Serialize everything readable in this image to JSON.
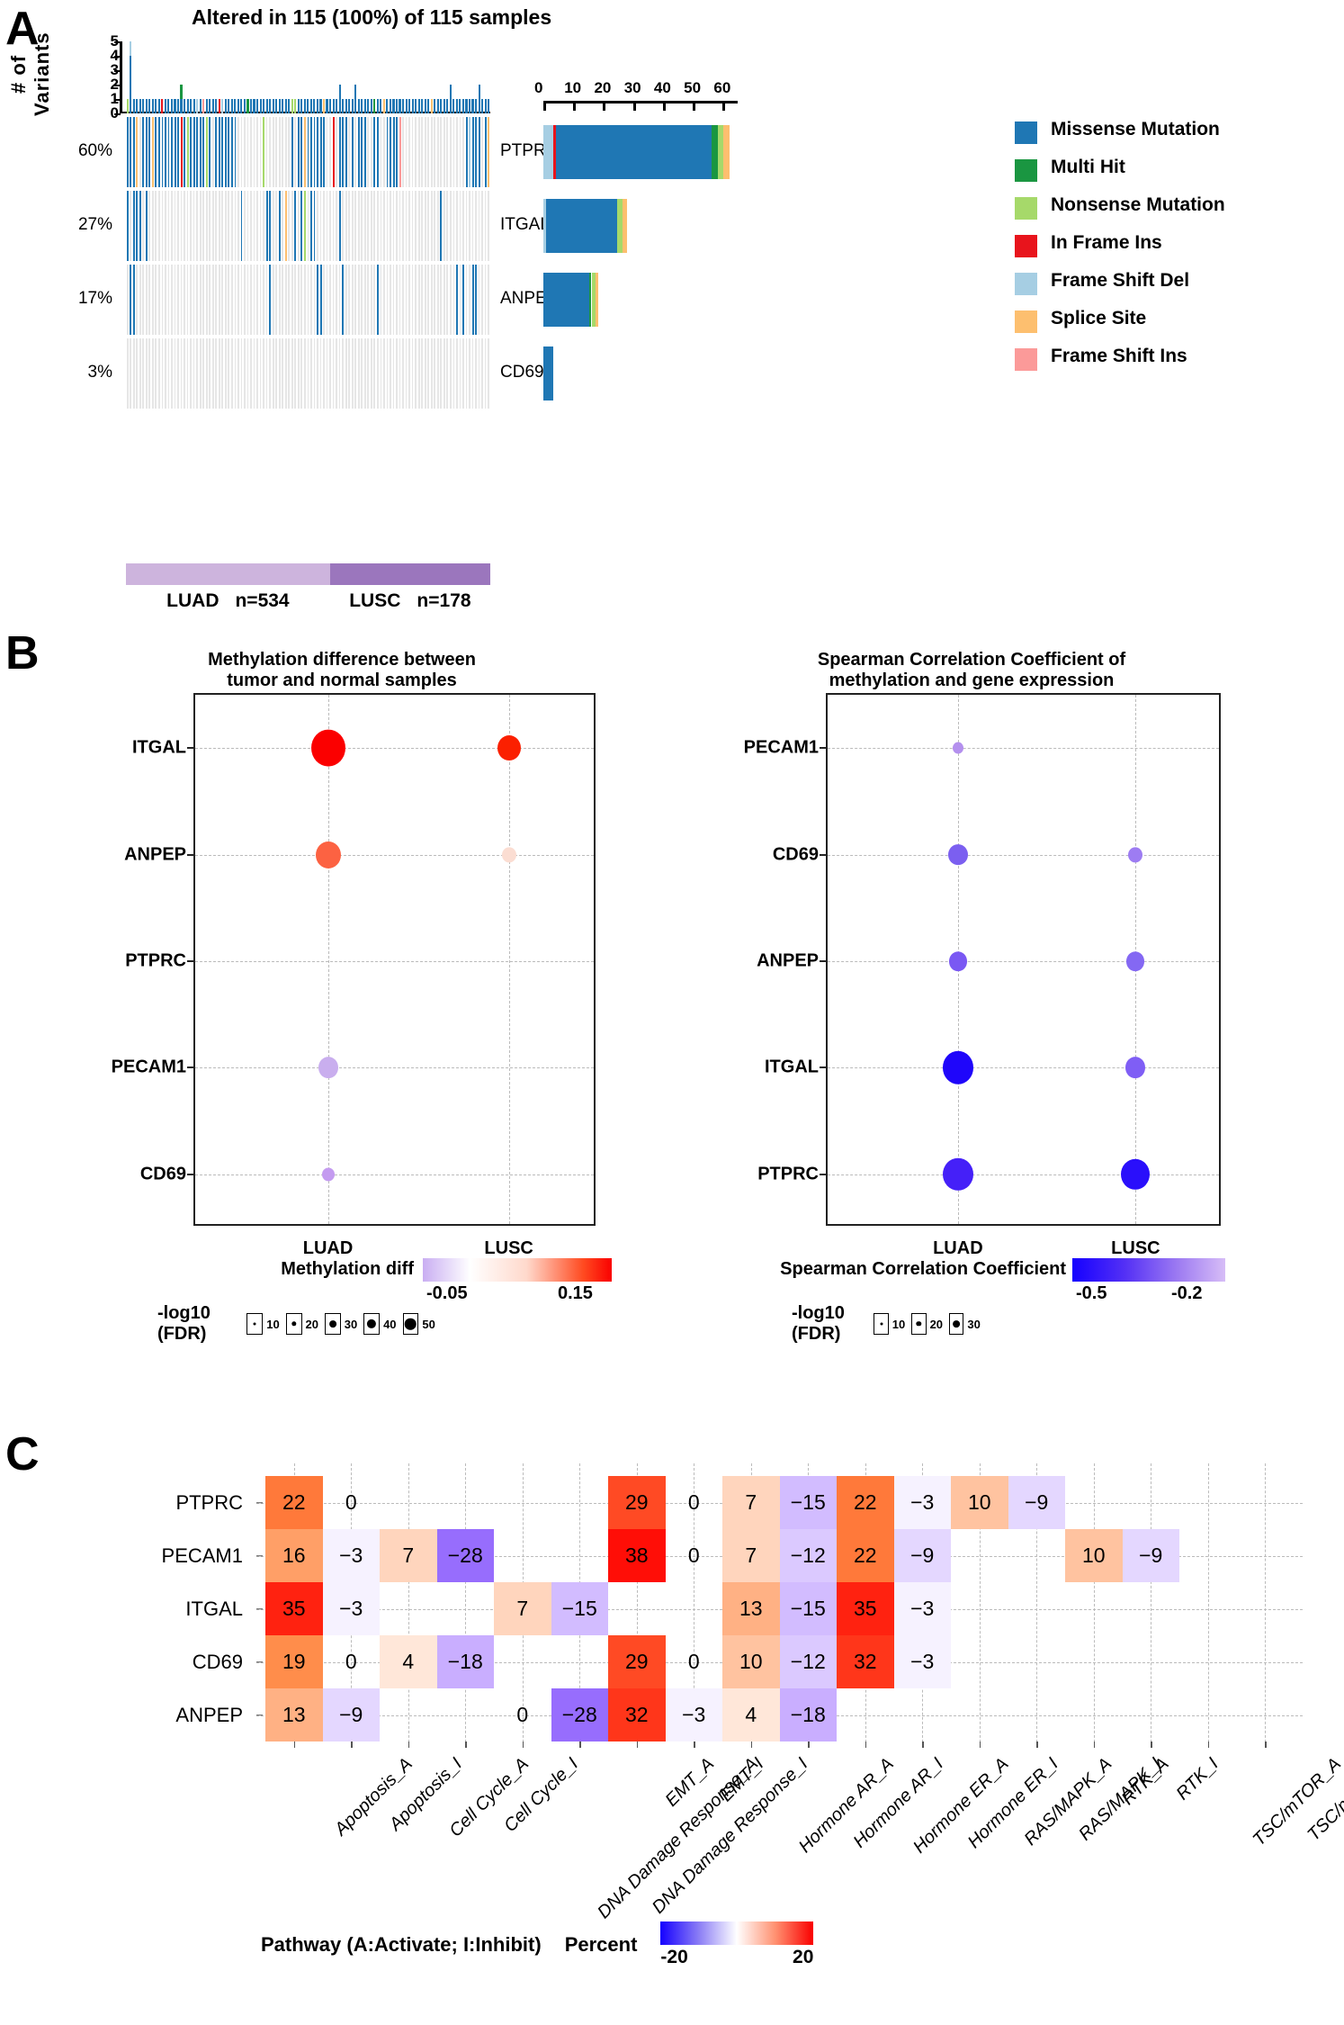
{
  "panelA": {
    "letter": "A",
    "title": "Altered in 115 (100%) of 115 samples",
    "yaxis_label": "# of Variants",
    "yaxis_ticks": [
      "5",
      "4",
      "3",
      "2",
      "1",
      "0"
    ],
    "genes": [
      "PTPRC",
      "ITGAL",
      "ANPEP",
      "CD69"
    ],
    "percents": [
      "60%",
      "27%",
      "17%",
      "3%"
    ],
    "bar_axis_ticks": [
      "0",
      "10",
      "20",
      "30",
      "40",
      "50",
      "60"
    ],
    "bar_axis_max": 65,
    "gene_bars": [
      {
        "gene": "PTPRC",
        "segments": [
          {
            "type": "Frame Shift Del",
            "value": 3.2
          },
          {
            "type": "In Frame Ins",
            "value": 1.0
          },
          {
            "type": "Missense Mutation",
            "value": 52.0
          },
          {
            "type": "Multi Hit",
            "value": 2.2
          },
          {
            "type": "Nonsense Mutation",
            "value": 1.9
          },
          {
            "type": "Splice Site",
            "value": 1.9
          }
        ]
      },
      {
        "gene": "ITGAL",
        "segments": [
          {
            "type": "Frame Shift Del",
            "value": 0.8
          },
          {
            "type": "Missense Mutation",
            "value": 24.0
          },
          {
            "type": "Nonsense Mutation",
            "value": 1.6
          },
          {
            "type": "Splice Site",
            "value": 1.6
          }
        ]
      },
      {
        "gene": "ANPEP",
        "segments": [
          {
            "type": "Missense Mutation",
            "value": 15.2
          },
          {
            "type": "Multi Hit",
            "value": 0.9
          },
          {
            "type": "Nonsense Mutation",
            "value": 1.3
          },
          {
            "type": "Splice Site",
            "value": 1.1
          }
        ]
      },
      {
        "gene": "CD69",
        "segments": [
          {
            "type": "Missense Mutation",
            "value": 3.4
          }
        ]
      }
    ],
    "legend": [
      {
        "label": "Missense Mutation",
        "color": "#1f77b4"
      },
      {
        "label": "Multi Hit",
        "color": "#1a9641"
      },
      {
        "label": "Nonsense Mutation",
        "color": "#a6d96a"
      },
      {
        "label": "In Frame Ins",
        "color": "#e8141c"
      },
      {
        "label": "Frame Shift Del",
        "color": "#a6cee3"
      },
      {
        "label": "Splice Site",
        "color": "#fdbf6f"
      },
      {
        "label": "Frame Shift Ins",
        "color": "#fb9a99"
      }
    ],
    "cohorts": [
      {
        "label": "LUAD",
        "n_label": "n=534",
        "color": "#cdb4dd",
        "fraction": 0.56
      },
      {
        "label": "LUSC",
        "n_label": "n=178",
        "color": "#9b76bd",
        "fraction": 0.44
      }
    ]
  },
  "panelB": {
    "letter": "B",
    "left": {
      "title": "Methylation difference between\ntumor and normal samples",
      "rows": [
        "ITGAL",
        "ANPEP",
        "PTPRC",
        "PECAM1",
        "CD69"
      ],
      "cols": [
        "LUAD",
        "LUSC"
      ],
      "colorbar_label": "Methylation diff",
      "colorbar_min": "-0.05",
      "colorbar_max": "0.15",
      "size_label": "-log10 (FDR)",
      "size_ticks": [
        "10",
        "20",
        "30",
        "40",
        "50"
      ]
    },
    "right": {
      "title": "Spearman Correlation Coefficient of\nmethylation and gene expression",
      "rows": [
        "PECAM1",
        "CD69",
        "ANPEP",
        "ITGAL",
        "PTPRC"
      ],
      "cols": [
        "LUAD",
        "LUSC"
      ],
      "colorbar_label": "Spearman Correlation Coefficient",
      "colorbar_min": "-0.5",
      "colorbar_max": "-0.2",
      "size_label": "-log10 (FDR)",
      "size_ticks": [
        "10",
        "20",
        "30"
      ]
    }
  },
  "panelC": {
    "letter": "C",
    "legend_axis_label": "Pathway (A:Activate; I:Inhibit)",
    "legend_color_label": "Percent",
    "legend_min": "-20",
    "legend_max": "20"
  },
  "chart_data": [
    {
      "type": "bar",
      "title": "Altered in 115 (100%) of 115 samples",
      "xlabel": "",
      "ylabel": "# of Variants",
      "ylim": [
        0,
        5
      ],
      "categories": [
        "PTPRC",
        "ITGAL",
        "ANPEP",
        "CD69"
      ],
      "values": [
        60,
        27,
        17,
        3
      ],
      "value_labels": [
        "60%",
        "27%",
        "17%",
        "3%"
      ],
      "note": "Oncoprint waterfall: per-gene mutated sample percentage; stacked right barplot counts by variant class"
    },
    {
      "type": "scatter",
      "title": "Methylation difference between tumor and normal samples",
      "xlabel": "",
      "ylabel": "",
      "categories": [
        "LUAD",
        "LUSC"
      ],
      "rows": [
        "ITGAL",
        "ANPEP",
        "PTPRC",
        "PECAM1",
        "CD69"
      ],
      "colorbar": {
        "label": "Methylation diff",
        "min": -0.05,
        "max": 0.15
      },
      "size_legend": {
        "label": "-log10 (FDR)",
        "ticks": [
          10,
          20,
          30,
          40,
          50
        ]
      },
      "points": [
        {
          "row": "ITGAL",
          "col": "LUAD",
          "value": 0.15,
          "fdr": 50,
          "color": "#fb0000",
          "radius": 19
        },
        {
          "row": "ITGAL",
          "col": "LUSC",
          "value": 0.14,
          "fdr": 26,
          "color": "#fb2000",
          "radius": 13
        },
        {
          "row": "ANPEP",
          "col": "LUAD",
          "value": 0.11,
          "fdr": 30,
          "color": "#fc6242",
          "radius": 14
        },
        {
          "row": "ANPEP",
          "col": "LUSC",
          "value": 0.03,
          "fdr": 6,
          "color": "#fbddd2",
          "radius": 8
        },
        {
          "row": "PTPRC",
          "col": "LUAD",
          "value": null,
          "fdr": null,
          "color": "none",
          "radius": 0
        },
        {
          "row": "PTPRC",
          "col": "LUSC",
          "value": null,
          "fdr": null,
          "color": "none",
          "radius": 0
        },
        {
          "row": "PECAM1",
          "col": "LUAD",
          "value": -0.02,
          "fdr": 16,
          "color": "#c9aeee",
          "radius": 11
        },
        {
          "row": "PECAM1",
          "col": "LUSC",
          "value": null,
          "fdr": null,
          "color": "none",
          "radius": 0
        },
        {
          "row": "CD69",
          "col": "LUAD",
          "value": -0.03,
          "fdr": 6,
          "color": "#c49bf0",
          "radius": 7
        },
        {
          "row": "CD69",
          "col": "LUSC",
          "value": null,
          "fdr": null,
          "color": "none",
          "radius": 0
        }
      ]
    },
    {
      "type": "scatter",
      "title": "Spearman Correlation Coefficient of methylation and gene expression",
      "xlabel": "",
      "ylabel": "",
      "categories": [
        "LUAD",
        "LUSC"
      ],
      "rows": [
        "PECAM1",
        "CD69",
        "ANPEP",
        "ITGAL",
        "PTPRC"
      ],
      "colorbar": {
        "label": "Spearman Correlation Coefficient",
        "min": -0.5,
        "max": -0.2
      },
      "size_legend": {
        "label": "-log10 (FDR)",
        "ticks": [
          10,
          20,
          30
        ]
      },
      "points": [
        {
          "row": "PECAM1",
          "col": "LUAD",
          "value": -0.22,
          "fdr": 4,
          "color": "#b490ee",
          "radius": 6
        },
        {
          "row": "PECAM1",
          "col": "LUSC",
          "value": null,
          "fdr": null,
          "color": "none",
          "radius": 0
        },
        {
          "row": "CD69",
          "col": "LUAD",
          "value": -0.33,
          "fdr": 14,
          "color": "#7b5ff0",
          "radius": 11
        },
        {
          "row": "CD69",
          "col": "LUSC",
          "value": -0.27,
          "fdr": 7,
          "color": "#9d7cf2",
          "radius": 8
        },
        {
          "row": "ANPEP",
          "col": "LUAD",
          "value": -0.3,
          "fdr": 11,
          "color": "#7a58f3",
          "radius": 10
        },
        {
          "row": "ANPEP",
          "col": "LUSC",
          "value": -0.29,
          "fdr": 10,
          "color": "#8468f3",
          "radius": 10
        },
        {
          "row": "ITGAL",
          "col": "LUAD",
          "value": -0.5,
          "fdr": 29,
          "color": "#1f06fa",
          "radius": 17
        },
        {
          "row": "ITGAL",
          "col": "LUSC",
          "value": -0.31,
          "fdr": 12,
          "color": "#7f5ef5",
          "radius": 11
        },
        {
          "row": "PTPRC",
          "col": "LUAD",
          "value": -0.44,
          "fdr": 28,
          "color": "#4520f8",
          "radius": 17
        },
        {
          "row": "PTPRC",
          "col": "LUSC",
          "value": -0.48,
          "fdr": 24,
          "color": "#2a0ffb",
          "radius": 16
        }
      ]
    },
    {
      "type": "heatmap",
      "title": "",
      "xlabel": "Pathway (A:Activate; I:Inhibit)",
      "ylabel": "",
      "colorbar": {
        "label": "Percent",
        "min": -20,
        "max": 20
      },
      "columns": [
        "Apoptosis_A",
        "Apoptosis_I",
        "Cell Cycle_A",
        "Cell Cycle_I",
        "DNA Damage Response_A",
        "DNA Damage Response_I",
        "EMT_A",
        "EMT_I",
        "Hormone AR_A",
        "Hormone AR_I",
        "Hormone ER_A",
        "Hormone ER_I",
        "RAS/MAPK_A",
        "RAS/MAPK_I",
        "RTK_A",
        "RTK_I",
        "TSC/mTOR_A",
        "TSC/mTOR_I"
      ],
      "rows": [
        "PTPRC",
        "PECAM1",
        "ITGAL",
        "CD69",
        "ANPEP"
      ],
      "values": [
        [
          22,
          0,
          null,
          null,
          null,
          null,
          29,
          0,
          7,
          -15,
          22,
          -3,
          10,
          -9,
          null,
          null,
          null,
          null
        ],
        [
          16,
          -3,
          7,
          -28,
          null,
          null,
          38,
          0,
          7,
          -12,
          22,
          -9,
          null,
          null,
          10,
          -9,
          null,
          null
        ],
        [
          35,
          -3,
          null,
          null,
          7,
          -15,
          null,
          null,
          13,
          -15,
          35,
          -3,
          null,
          null,
          null,
          null,
          null,
          null
        ],
        [
          19,
          0,
          4,
          -18,
          null,
          null,
          29,
          0,
          10,
          -12,
          32,
          -3,
          null,
          null,
          null,
          null,
          null,
          null
        ],
        [
          13,
          -9,
          null,
          null,
          0,
          -28,
          32,
          -3,
          4,
          -18,
          null,
          null,
          null,
          null,
          null,
          null,
          null,
          null
        ]
      ]
    }
  ]
}
